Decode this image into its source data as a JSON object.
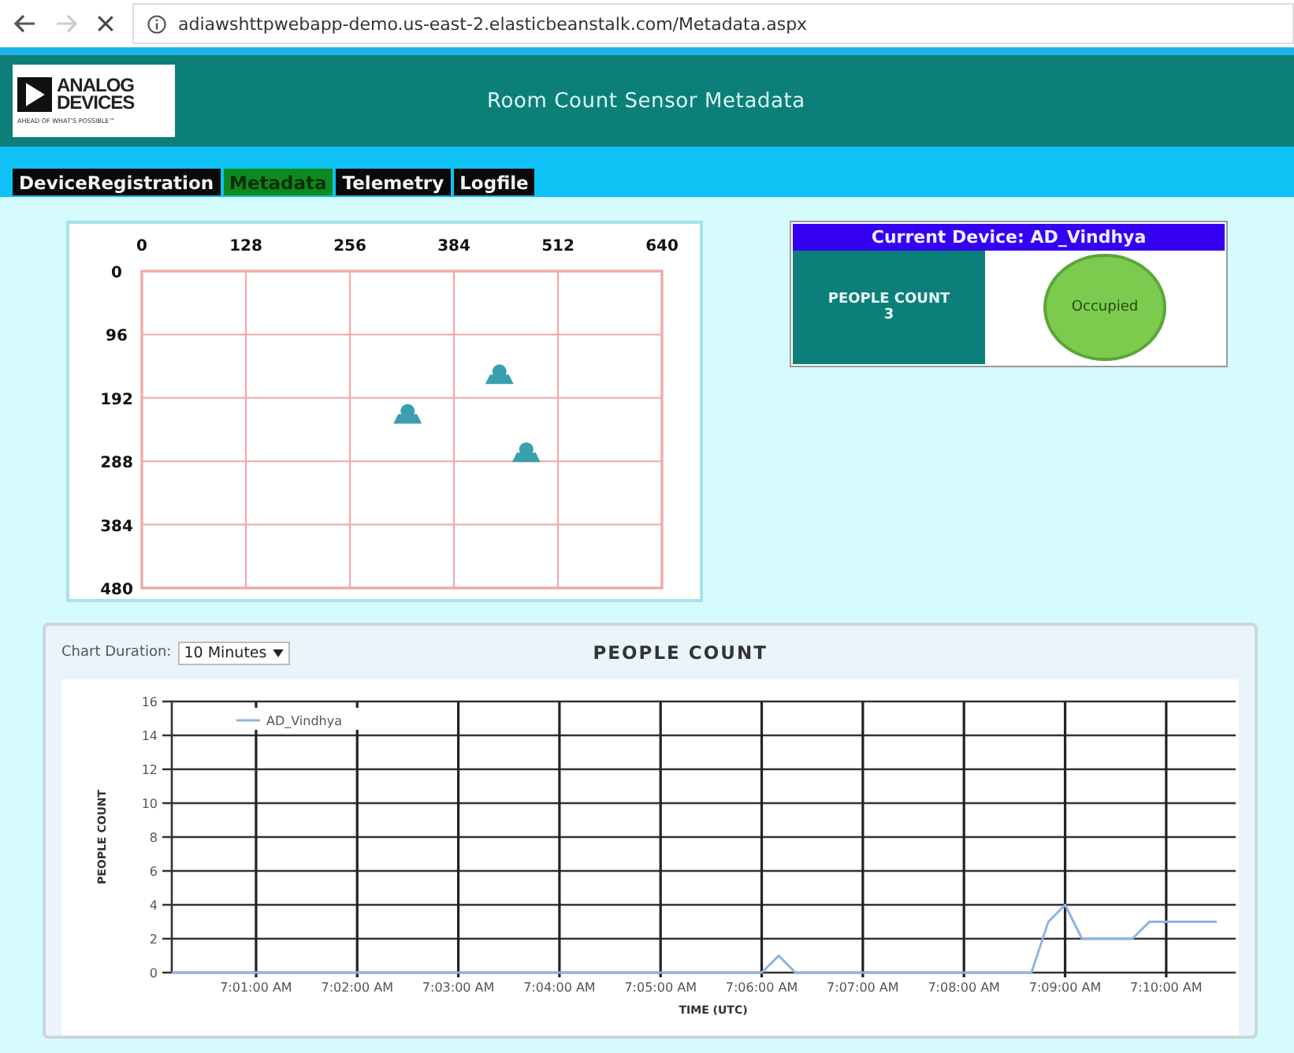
{
  "browser": {
    "url": "adiawshttpwebapp-demo.us-east-2.elasticbeanstalk.com/Metadata.aspx"
  },
  "header": {
    "logo_line1": "ANALOG",
    "logo_line2": "DEVICES",
    "logo_tagline": "AHEAD OF WHAT'S POSSIBLE™",
    "title": "Room Count Sensor Metadata"
  },
  "tabs": [
    {
      "label": "DeviceRegistration",
      "selected": false
    },
    {
      "label": "Metadata",
      "selected": true
    },
    {
      "label": "Telemetry",
      "selected": false
    },
    {
      "label": "Logfile",
      "selected": false
    }
  ],
  "floor_map": {
    "chart_data": {
      "type": "scatter",
      "x": [
        327,
        440,
        473
      ],
      "values": [
        224,
        164,
        282
      ],
      "grid": true,
      "xlim": [
        0,
        640
      ],
      "ylim": [
        480,
        0
      ],
      "xticks": [
        0,
        128,
        256,
        384,
        512,
        640
      ],
      "yticks": [
        0,
        96,
        192,
        288,
        384,
        480
      ]
    }
  },
  "device": {
    "title": "Current Device: AD_Vindhya",
    "count_label": "PEOPLE COUNT",
    "count": "3",
    "status": "Occupied",
    "occupied": true
  },
  "trend": {
    "duration_label": "Chart Duration:",
    "duration": "10 Minutes",
    "chart_data": {
      "type": "line",
      "title": "PEOPLE COUNT",
      "xlabel": "TIME (UTC)",
      "ylabel": "PEOPLE COUNT",
      "grid": true,
      "ylim": [
        0,
        16
      ],
      "categories": [
        null,
        null,
        null,
        null,
        null,
        "7:01:00 AM",
        null,
        null,
        null,
        null,
        null,
        "7:02:00 AM",
        null,
        null,
        null,
        null,
        null,
        "7:03:00 AM",
        null,
        null,
        null,
        null,
        null,
        "7:04:00 AM",
        null,
        null,
        null,
        null,
        null,
        "7:05:00 AM",
        null,
        null,
        null,
        null,
        null,
        "7:06:00 AM",
        null,
        null,
        null,
        null,
        null,
        "7:07:00 AM",
        null,
        null,
        null,
        null,
        null,
        "7:08:00 AM",
        null,
        null,
        null,
        null,
        null,
        "7:09:00 AM",
        null,
        null,
        null,
        null,
        null,
        "7:10:00 AM",
        null,
        null,
        null
      ],
      "series": [
        {
          "name": "AD_Vindhya",
          "color": "#8fb4e3",
          "values": [
            0,
            0,
            0,
            0,
            0,
            0,
            0,
            0,
            0,
            0,
            0,
            0,
            0,
            0,
            0,
            0,
            0,
            0,
            0,
            0,
            0,
            0,
            0,
            0,
            0,
            0,
            0,
            0,
            0,
            0,
            0,
            0,
            0,
            0,
            0,
            0,
            1,
            0,
            0,
            0,
            0,
            0,
            0,
            0,
            0,
            0,
            0,
            0,
            0,
            0,
            0,
            0,
            3,
            4,
            2,
            2,
            2,
            2,
            3,
            3,
            3,
            3,
            3
          ]
        }
      ],
      "yticks": [
        0,
        2,
        4,
        6,
        8,
        10,
        12,
        14,
        16
      ]
    }
  }
}
